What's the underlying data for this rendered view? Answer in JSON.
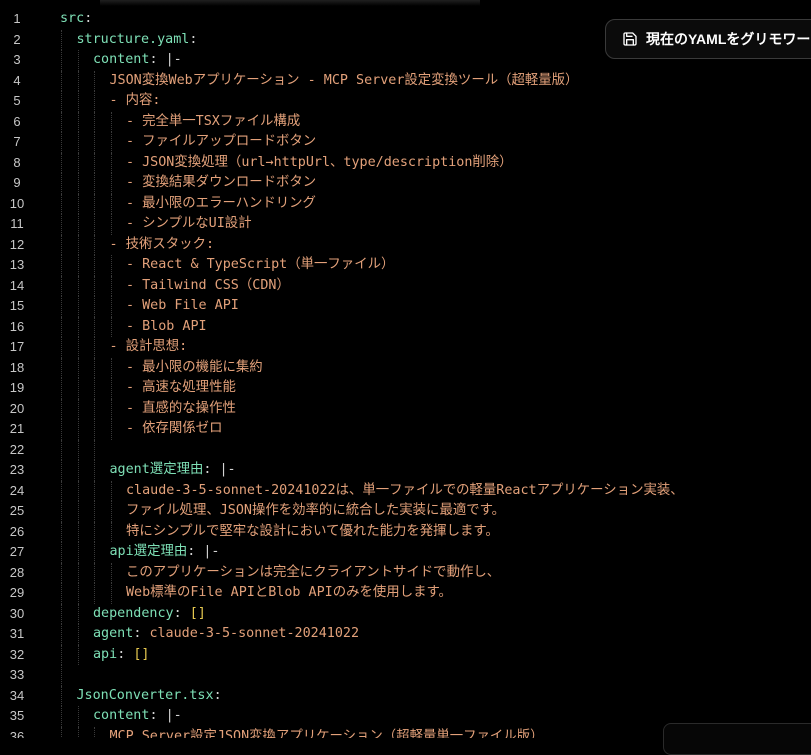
{
  "toolbar": {
    "save_label": "現在のYAMLをグリモワー",
    "save_icon": "save-icon"
  },
  "code_lines": [
    {
      "n": "1",
      "indent": 0,
      "parts": [
        {
          "t": "src",
          "c": "key"
        },
        {
          "t": ":",
          "c": "punc"
        }
      ]
    },
    {
      "n": "2",
      "indent": 1,
      "parts": [
        {
          "t": "structure.yaml",
          "c": "key"
        },
        {
          "t": ":",
          "c": "punc"
        }
      ]
    },
    {
      "n": "3",
      "indent": 2,
      "parts": [
        {
          "t": "content",
          "c": "key"
        },
        {
          "t": ": ",
          "c": "punc"
        },
        {
          "t": "|-",
          "c": "punc"
        }
      ]
    },
    {
      "n": "4",
      "indent": 3,
      "parts": [
        {
          "t": "JSON変換Webアプリケーション - MCP Server設定変換ツール（超軽量版）",
          "c": "str"
        }
      ]
    },
    {
      "n": "5",
      "indent": 3,
      "parts": [
        {
          "t": "- 内容:",
          "c": "str"
        }
      ]
    },
    {
      "n": "6",
      "indent": 4,
      "parts": [
        {
          "t": "- 完全単一TSXファイル構成",
          "c": "str"
        }
      ]
    },
    {
      "n": "7",
      "indent": 4,
      "parts": [
        {
          "t": "- ファイルアップロードボタン",
          "c": "str"
        }
      ]
    },
    {
      "n": "8",
      "indent": 4,
      "parts": [
        {
          "t": "- JSON変換処理（url→httpUrl、type/description削除）",
          "c": "str"
        }
      ]
    },
    {
      "n": "9",
      "indent": 4,
      "parts": [
        {
          "t": "- 変換結果ダウンロードボタン",
          "c": "str"
        }
      ]
    },
    {
      "n": "10",
      "indent": 4,
      "parts": [
        {
          "t": "- 最小限のエラーハンドリング",
          "c": "str"
        }
      ]
    },
    {
      "n": "11",
      "indent": 4,
      "parts": [
        {
          "t": "- シンプルなUI設計",
          "c": "str"
        }
      ]
    },
    {
      "n": "12",
      "indent": 3,
      "parts": [
        {
          "t": "- 技術スタック:",
          "c": "str"
        }
      ]
    },
    {
      "n": "13",
      "indent": 4,
      "parts": [
        {
          "t": "- React & TypeScript（単一ファイル）",
          "c": "str"
        }
      ]
    },
    {
      "n": "14",
      "indent": 4,
      "parts": [
        {
          "t": "- Tailwind CSS（CDN）",
          "c": "str"
        }
      ]
    },
    {
      "n": "15",
      "indent": 4,
      "parts": [
        {
          "t": "- Web File API",
          "c": "str"
        }
      ]
    },
    {
      "n": "16",
      "indent": 4,
      "parts": [
        {
          "t": "- Blob API",
          "c": "str"
        }
      ]
    },
    {
      "n": "17",
      "indent": 3,
      "parts": [
        {
          "t": "- 設計思想:",
          "c": "str"
        }
      ]
    },
    {
      "n": "18",
      "indent": 4,
      "parts": [
        {
          "t": "- 最小限の機能に集約",
          "c": "str"
        }
      ]
    },
    {
      "n": "19",
      "indent": 4,
      "parts": [
        {
          "t": "- 高速な処理性能",
          "c": "str"
        }
      ]
    },
    {
      "n": "20",
      "indent": 4,
      "parts": [
        {
          "t": "- 直感的な操作性",
          "c": "str"
        }
      ]
    },
    {
      "n": "21",
      "indent": 4,
      "parts": [
        {
          "t": "- 依存関係ゼロ",
          "c": "str"
        }
      ]
    },
    {
      "n": "22",
      "indent": 3,
      "parts": []
    },
    {
      "n": "23",
      "indent": 3,
      "parts": [
        {
          "t": "agent選定理由",
          "c": "key"
        },
        {
          "t": ": ",
          "c": "punc"
        },
        {
          "t": "|-",
          "c": "punc"
        }
      ]
    },
    {
      "n": "24",
      "indent": 4,
      "parts": [
        {
          "t": "claude-3-5-sonnet-20241022は、単一ファイルでの軽量Reactアプリケーション実装、",
          "c": "str"
        }
      ]
    },
    {
      "n": "25",
      "indent": 4,
      "parts": [
        {
          "t": "ファイル処理、JSON操作を効率的に統合した実装に最適です。",
          "c": "str"
        }
      ]
    },
    {
      "n": "26",
      "indent": 4,
      "parts": [
        {
          "t": "特にシンプルで堅牢な設計において優れた能力を発揮します。",
          "c": "str"
        }
      ]
    },
    {
      "n": "27",
      "indent": 3,
      "parts": [
        {
          "t": "api選定理由",
          "c": "key"
        },
        {
          "t": ": ",
          "c": "punc"
        },
        {
          "t": "|-",
          "c": "punc"
        }
      ]
    },
    {
      "n": "28",
      "indent": 4,
      "parts": [
        {
          "t": "このアプリケーションは完全にクライアントサイドで動作し、",
          "c": "str"
        }
      ]
    },
    {
      "n": "29",
      "indent": 4,
      "parts": [
        {
          "t": "Web標準のFile APIとBlob APIのみを使用します。",
          "c": "str"
        }
      ]
    },
    {
      "n": "30",
      "indent": 2,
      "parts": [
        {
          "t": "dependency",
          "c": "key"
        },
        {
          "t": ": ",
          "c": "punc"
        },
        {
          "t": "[]",
          "c": "brk"
        }
      ]
    },
    {
      "n": "31",
      "indent": 2,
      "parts": [
        {
          "t": "agent",
          "c": "key"
        },
        {
          "t": ": ",
          "c": "punc"
        },
        {
          "t": "claude-3-5-sonnet-20241022",
          "c": "str"
        }
      ]
    },
    {
      "n": "32",
      "indent": 2,
      "parts": [
        {
          "t": "api",
          "c": "key"
        },
        {
          "t": ": ",
          "c": "punc"
        },
        {
          "t": "[]",
          "c": "brk"
        }
      ]
    },
    {
      "n": "33",
      "indent": 1,
      "parts": []
    },
    {
      "n": "34",
      "indent": 1,
      "parts": [
        {
          "t": "JsonConverter.tsx",
          "c": "key"
        },
        {
          "t": ":",
          "c": "punc"
        }
      ]
    },
    {
      "n": "35",
      "indent": 2,
      "parts": [
        {
          "t": "content",
          "c": "key"
        },
        {
          "t": ": ",
          "c": "punc"
        },
        {
          "t": "|-",
          "c": "punc"
        }
      ]
    },
    {
      "n": "36",
      "indent": 3,
      "parts": [
        {
          "t": "MCP Server設定JSON変換アプリケーション（超軽量単一ファイル版）",
          "c": "str"
        }
      ]
    }
  ]
}
